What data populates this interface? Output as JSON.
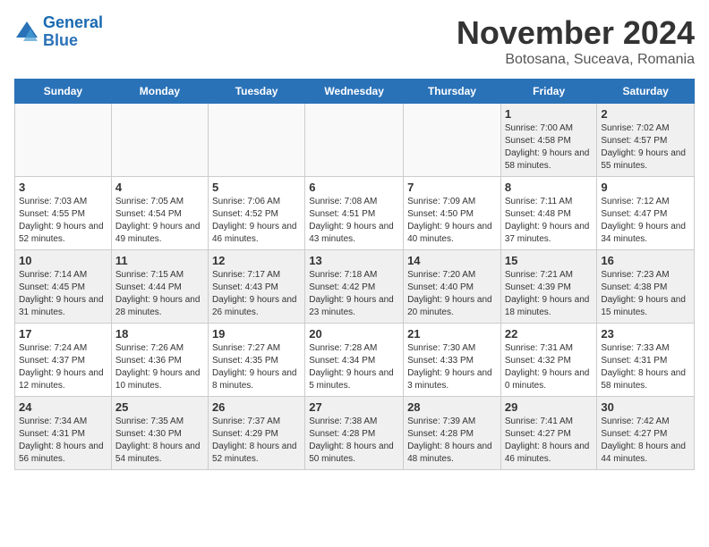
{
  "logo": {
    "line1": "General",
    "line2": "Blue"
  },
  "title": "November 2024",
  "subtitle": "Botosana, Suceava, Romania",
  "days_of_week": [
    "Sunday",
    "Monday",
    "Tuesday",
    "Wednesday",
    "Thursday",
    "Friday",
    "Saturday"
  ],
  "weeks": [
    [
      {
        "day": "",
        "info": ""
      },
      {
        "day": "",
        "info": ""
      },
      {
        "day": "",
        "info": ""
      },
      {
        "day": "",
        "info": ""
      },
      {
        "day": "",
        "info": ""
      },
      {
        "day": "1",
        "info": "Sunrise: 7:00 AM\nSunset: 4:58 PM\nDaylight: 9 hours and 58 minutes."
      },
      {
        "day": "2",
        "info": "Sunrise: 7:02 AM\nSunset: 4:57 PM\nDaylight: 9 hours and 55 minutes."
      }
    ],
    [
      {
        "day": "3",
        "info": "Sunrise: 7:03 AM\nSunset: 4:55 PM\nDaylight: 9 hours and 52 minutes."
      },
      {
        "day": "4",
        "info": "Sunrise: 7:05 AM\nSunset: 4:54 PM\nDaylight: 9 hours and 49 minutes."
      },
      {
        "day": "5",
        "info": "Sunrise: 7:06 AM\nSunset: 4:52 PM\nDaylight: 9 hours and 46 minutes."
      },
      {
        "day": "6",
        "info": "Sunrise: 7:08 AM\nSunset: 4:51 PM\nDaylight: 9 hours and 43 minutes."
      },
      {
        "day": "7",
        "info": "Sunrise: 7:09 AM\nSunset: 4:50 PM\nDaylight: 9 hours and 40 minutes."
      },
      {
        "day": "8",
        "info": "Sunrise: 7:11 AM\nSunset: 4:48 PM\nDaylight: 9 hours and 37 minutes."
      },
      {
        "day": "9",
        "info": "Sunrise: 7:12 AM\nSunset: 4:47 PM\nDaylight: 9 hours and 34 minutes."
      }
    ],
    [
      {
        "day": "10",
        "info": "Sunrise: 7:14 AM\nSunset: 4:45 PM\nDaylight: 9 hours and 31 minutes."
      },
      {
        "day": "11",
        "info": "Sunrise: 7:15 AM\nSunset: 4:44 PM\nDaylight: 9 hours and 28 minutes."
      },
      {
        "day": "12",
        "info": "Sunrise: 7:17 AM\nSunset: 4:43 PM\nDaylight: 9 hours and 26 minutes."
      },
      {
        "day": "13",
        "info": "Sunrise: 7:18 AM\nSunset: 4:42 PM\nDaylight: 9 hours and 23 minutes."
      },
      {
        "day": "14",
        "info": "Sunrise: 7:20 AM\nSunset: 4:40 PM\nDaylight: 9 hours and 20 minutes."
      },
      {
        "day": "15",
        "info": "Sunrise: 7:21 AM\nSunset: 4:39 PM\nDaylight: 9 hours and 18 minutes."
      },
      {
        "day": "16",
        "info": "Sunrise: 7:23 AM\nSunset: 4:38 PM\nDaylight: 9 hours and 15 minutes."
      }
    ],
    [
      {
        "day": "17",
        "info": "Sunrise: 7:24 AM\nSunset: 4:37 PM\nDaylight: 9 hours and 12 minutes."
      },
      {
        "day": "18",
        "info": "Sunrise: 7:26 AM\nSunset: 4:36 PM\nDaylight: 9 hours and 10 minutes."
      },
      {
        "day": "19",
        "info": "Sunrise: 7:27 AM\nSunset: 4:35 PM\nDaylight: 9 hours and 8 minutes."
      },
      {
        "day": "20",
        "info": "Sunrise: 7:28 AM\nSunset: 4:34 PM\nDaylight: 9 hours and 5 minutes."
      },
      {
        "day": "21",
        "info": "Sunrise: 7:30 AM\nSunset: 4:33 PM\nDaylight: 9 hours and 3 minutes."
      },
      {
        "day": "22",
        "info": "Sunrise: 7:31 AM\nSunset: 4:32 PM\nDaylight: 9 hours and 0 minutes."
      },
      {
        "day": "23",
        "info": "Sunrise: 7:33 AM\nSunset: 4:31 PM\nDaylight: 8 hours and 58 minutes."
      }
    ],
    [
      {
        "day": "24",
        "info": "Sunrise: 7:34 AM\nSunset: 4:31 PM\nDaylight: 8 hours and 56 minutes."
      },
      {
        "day": "25",
        "info": "Sunrise: 7:35 AM\nSunset: 4:30 PM\nDaylight: 8 hours and 54 minutes."
      },
      {
        "day": "26",
        "info": "Sunrise: 7:37 AM\nSunset: 4:29 PM\nDaylight: 8 hours and 52 minutes."
      },
      {
        "day": "27",
        "info": "Sunrise: 7:38 AM\nSunset: 4:28 PM\nDaylight: 8 hours and 50 minutes."
      },
      {
        "day": "28",
        "info": "Sunrise: 7:39 AM\nSunset: 4:28 PM\nDaylight: 8 hours and 48 minutes."
      },
      {
        "day": "29",
        "info": "Sunrise: 7:41 AM\nSunset: 4:27 PM\nDaylight: 8 hours and 46 minutes."
      },
      {
        "day": "30",
        "info": "Sunrise: 7:42 AM\nSunset: 4:27 PM\nDaylight: 8 hours and 44 minutes."
      }
    ]
  ]
}
